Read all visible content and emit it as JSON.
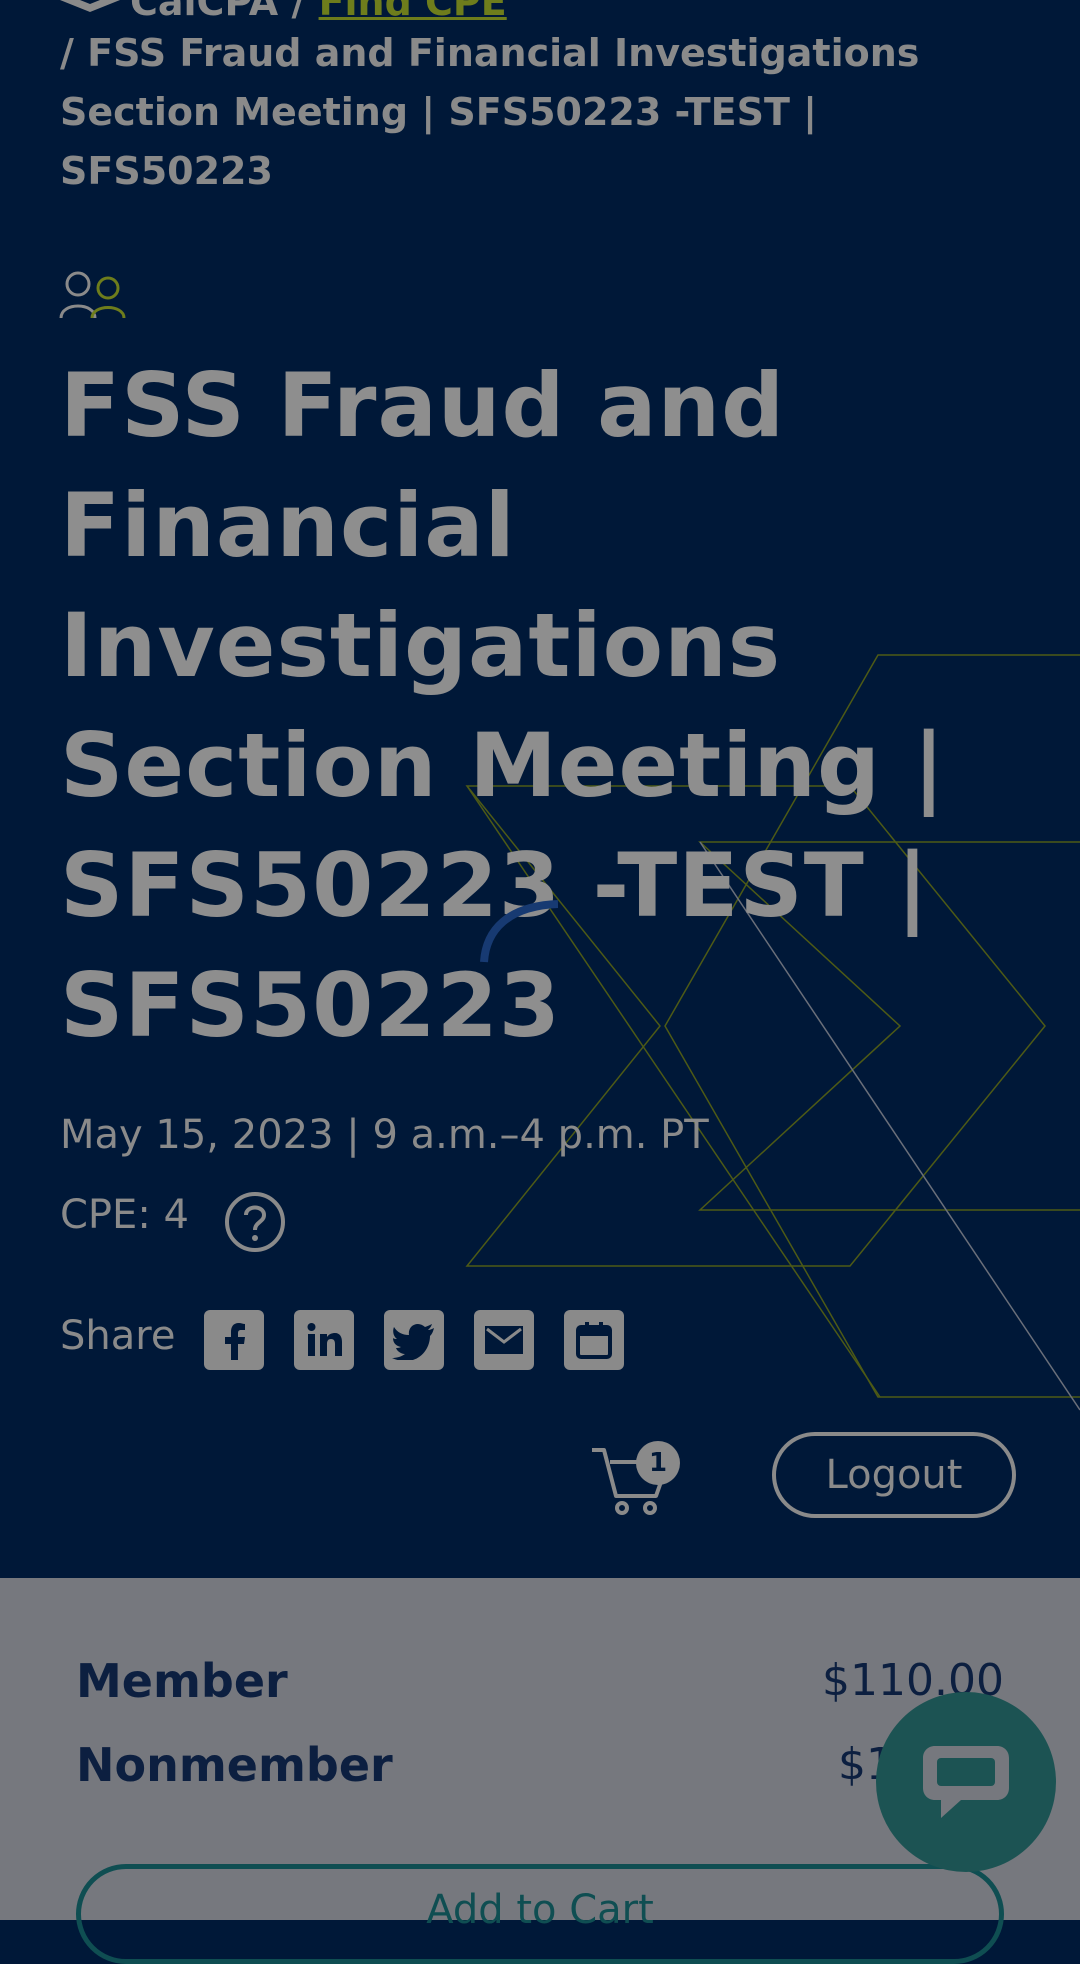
{
  "breadcrumb": {
    "home_label": "CalCPA /",
    "link_label": "Find CPE",
    "current": "/ FSS Fraud and Financial Investigations Section Meeting | SFS50223 -TEST | SFS50223"
  },
  "event": {
    "title": "FSS Fraud and Financial Investigations Section Meeting | SFS50223 -TEST | SFS50223",
    "date_time": "May 15, 2023 | 9 a.m.–4 p.m. PT",
    "cpe": "CPE: 4"
  },
  "share": {
    "label": "Share",
    "icons": [
      "facebook-icon",
      "linkedin-icon",
      "twitter-icon",
      "email-icon",
      "calendar-icon"
    ]
  },
  "header": {
    "cart_count": "1",
    "logout_label": "Logout"
  },
  "pricing": {
    "member_label": "Member",
    "member_price": "$110.00",
    "nonmember_label": "Nonmember",
    "nonmember_price": "$1",
    "add_to_cart_label": "Add to Cart"
  },
  "colors": {
    "background": "#001838",
    "overlay_text": "#8a8a8a",
    "accent_green": "#6e7d1c",
    "pricing_panel": "#76787e",
    "chat_button": "#1c5353"
  }
}
